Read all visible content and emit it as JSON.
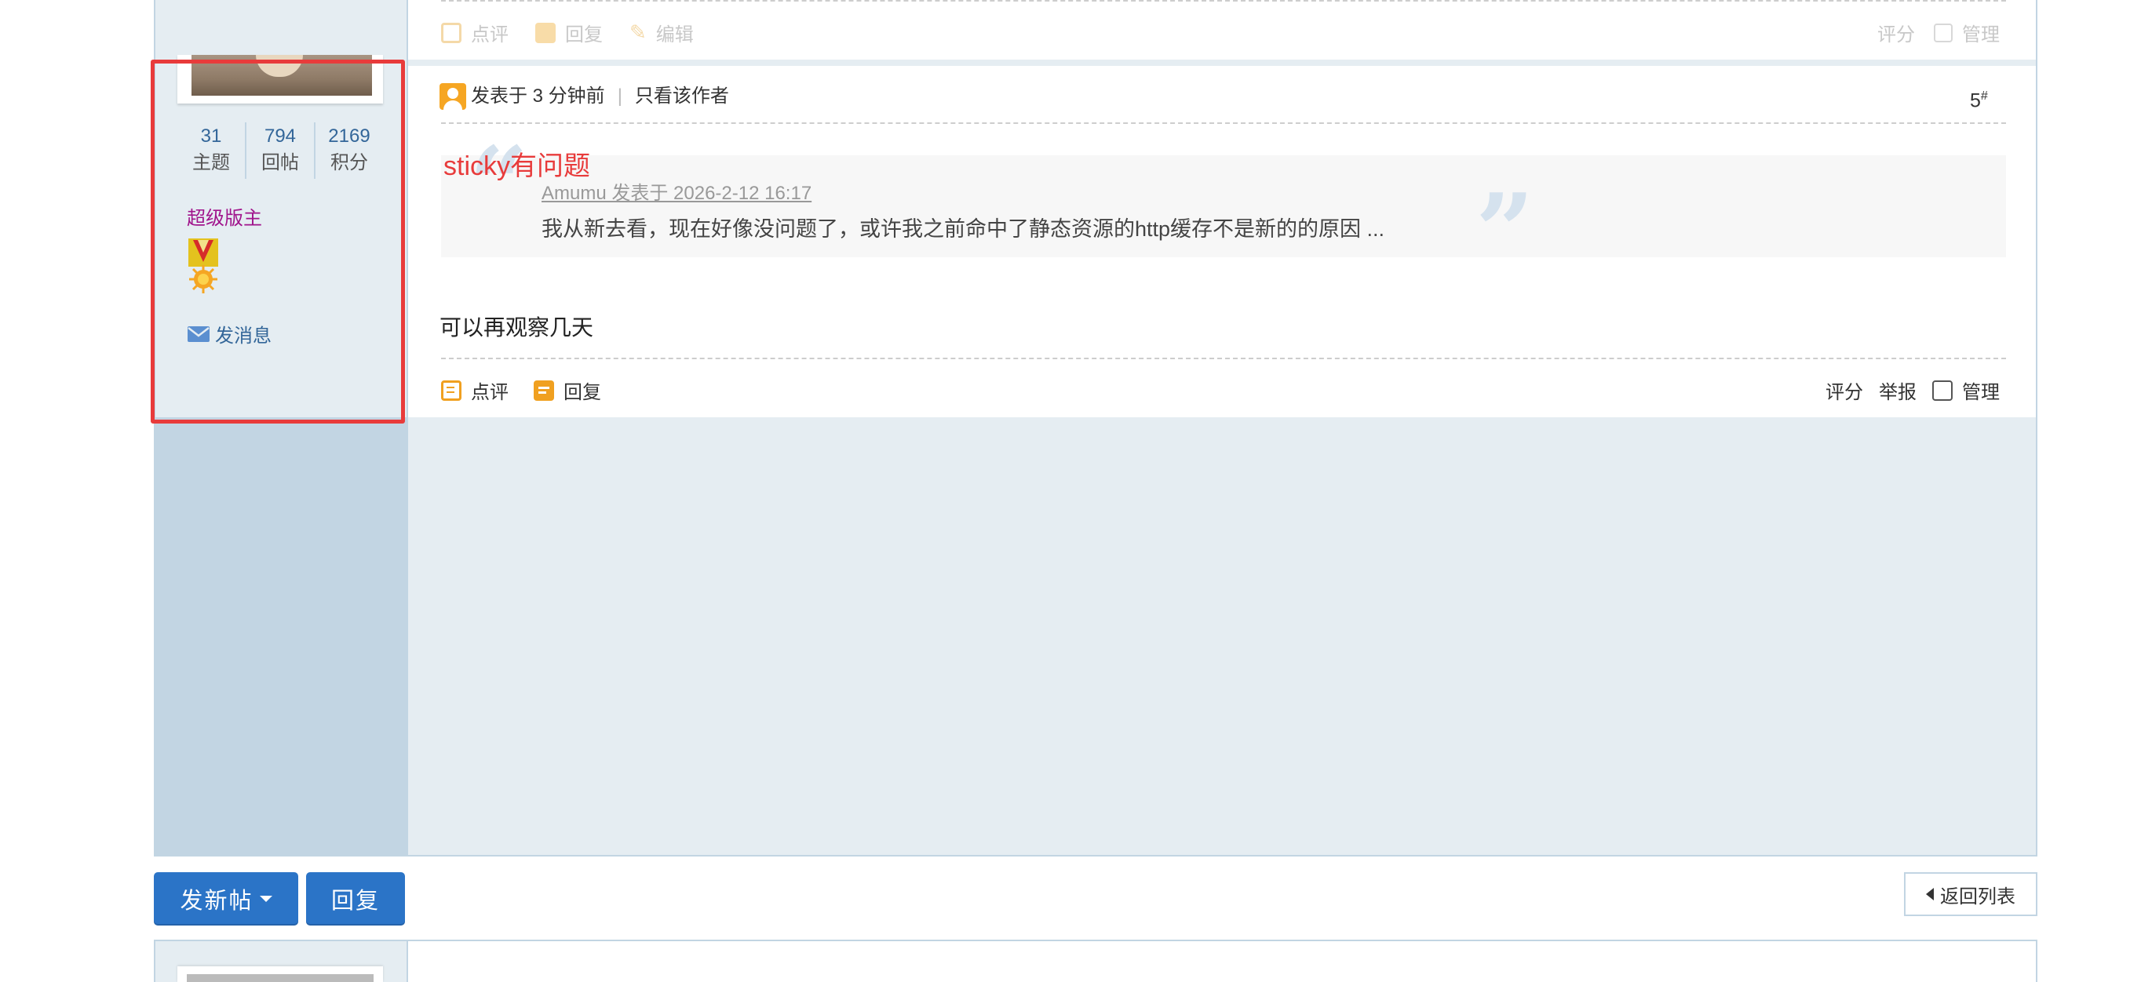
{
  "prev_post_toolbar": {
    "comment": "点评",
    "reply": "回复",
    "edit": "编辑",
    "rate": "评分",
    "manage": "管理"
  },
  "user": {
    "stats": [
      {
        "value": "31",
        "label": "主题"
      },
      {
        "value": "794",
        "label": "回帖"
      },
      {
        "value": "2169",
        "label": "积分"
      }
    ],
    "group": "超级版主",
    "send_message": "发消息"
  },
  "post": {
    "posted": "发表于 3 分钟前",
    "separator": "|",
    "only_author": "只看该作者",
    "floor_number": "5",
    "floor_sup": "#",
    "annotation": "sticky有问题",
    "quote": {
      "author_line": "Amumu 发表于 2026-2-12 16:17",
      "text": "我从新去看，现在好像没问题了，或许我之前命中了静态资源的http缓存不是新的的原因 ..."
    },
    "body": "可以再观察几天",
    "toolbar": {
      "comment": "点评",
      "reply": "回复",
      "rate": "评分",
      "report": "举报",
      "manage": "管理"
    }
  },
  "bottom_bar": {
    "new_post": "发新帖",
    "reply": "回复",
    "back_to_list": "返回列表"
  },
  "colors": {
    "accent_blue": "#2b74c7",
    "link_blue": "#336699",
    "moderator_purple": "#a0148c",
    "annotation_red": "#e83b3b",
    "icon_orange": "#f0a020"
  }
}
